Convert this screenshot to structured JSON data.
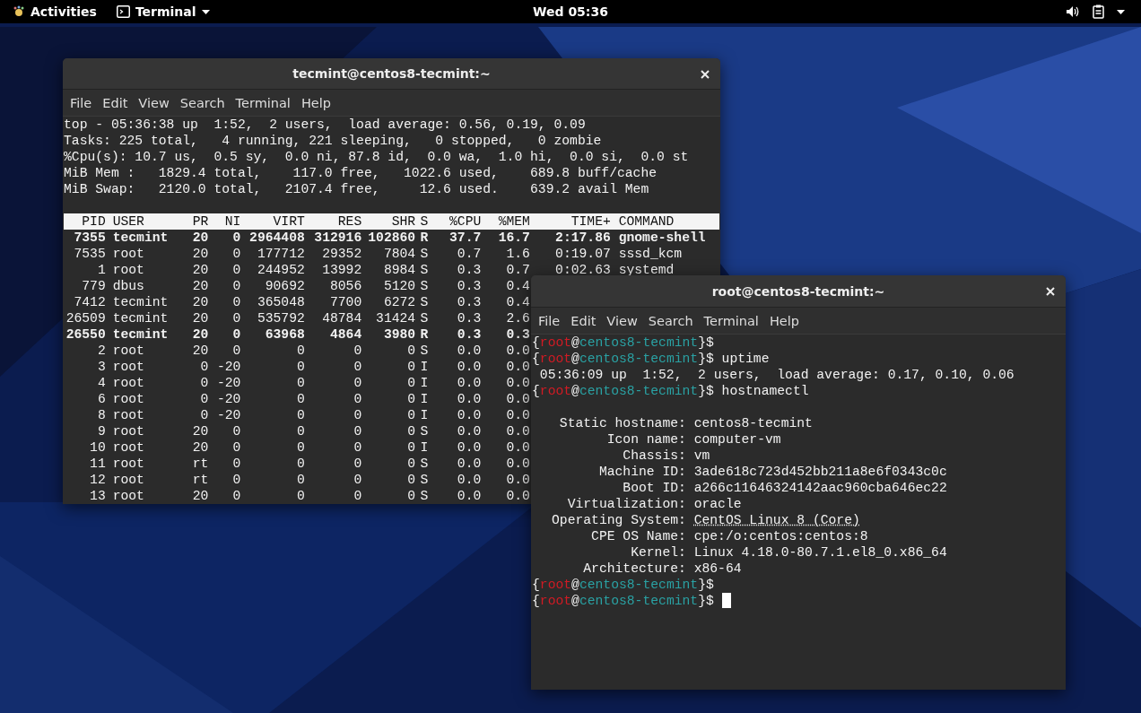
{
  "top_bar": {
    "activities": "Activities",
    "app_menu": "Terminal",
    "clock": "Wed 05:36"
  },
  "windows": [
    {
      "title": "tecmint@centos8-tecmint:~",
      "menu": [
        "File",
        "Edit",
        "View",
        "Search",
        "Terminal",
        "Help"
      ],
      "summary": [
        "top - 05:36:38 up  1:52,  2 users,  load average: 0.56, 0.19, 0.09",
        "Tasks: 225 total,   4 running, 221 sleeping,   0 stopped,   0 zombie",
        "%Cpu(s): 10.7 us,  0.5 sy,  0.0 ni, 87.8 id,  0.0 wa,  1.0 hi,  0.0 si,  0.0 st",
        "MiB Mem :   1829.4 total,    117.0 free,   1022.6 used,    689.8 buff/cache",
        "MiB Swap:   2120.0 total,   2107.4 free,     12.6 used.    639.2 avail Mem"
      ],
      "columns": [
        "PID",
        "USER",
        "PR",
        "NI",
        "VIRT",
        "RES",
        "SHR",
        "S",
        "%CPU",
        "%MEM",
        "TIME+",
        "COMMAND"
      ],
      "rows": [
        {
          "cells": [
            "7355",
            "tecmint",
            "20",
            "0",
            "2964408",
            "312916",
            "102860",
            "R",
            "37.7",
            "16.7",
            "2:17.86",
            "gnome-shell"
          ],
          "bold": true
        },
        {
          "cells": [
            "7535",
            "root",
            "20",
            "0",
            "177712",
            "29352",
            "7804",
            "S",
            "0.7",
            "1.6",
            "0:19.07",
            "sssd_kcm"
          ],
          "bold": false
        },
        {
          "cells": [
            "1",
            "root",
            "20",
            "0",
            "244952",
            "13992",
            "8984",
            "S",
            "0.3",
            "0.7",
            "0:02.63",
            "systemd"
          ],
          "bold": false
        },
        {
          "cells": [
            "779",
            "dbus",
            "20",
            "0",
            "90692",
            "8056",
            "5120",
            "S",
            "0.3",
            "0.4"
          ],
          "bold": false
        },
        {
          "cells": [
            "7412",
            "tecmint",
            "20",
            "0",
            "365048",
            "7700",
            "6272",
            "S",
            "0.3",
            "0.4"
          ],
          "bold": false
        },
        {
          "cells": [
            "26509",
            "tecmint",
            "20",
            "0",
            "535792",
            "48784",
            "31424",
            "S",
            "0.3",
            "2.6"
          ],
          "bold": false
        },
        {
          "cells": [
            "26550",
            "tecmint",
            "20",
            "0",
            "63968",
            "4864",
            "3980",
            "R",
            "0.3",
            "0.3"
          ],
          "bold": true
        },
        {
          "cells": [
            "2",
            "root",
            "20",
            "0",
            "0",
            "0",
            "0",
            "S",
            "0.0",
            "0.0"
          ],
          "bold": false
        },
        {
          "cells": [
            "3",
            "root",
            "0",
            "-20",
            "0",
            "0",
            "0",
            "I",
            "0.0",
            "0.0"
          ],
          "bold": false
        },
        {
          "cells": [
            "4",
            "root",
            "0",
            "-20",
            "0",
            "0",
            "0",
            "I",
            "0.0",
            "0.0"
          ],
          "bold": false
        },
        {
          "cells": [
            "6",
            "root",
            "0",
            "-20",
            "0",
            "0",
            "0",
            "I",
            "0.0",
            "0.0"
          ],
          "bold": false
        },
        {
          "cells": [
            "8",
            "root",
            "0",
            "-20",
            "0",
            "0",
            "0",
            "I",
            "0.0",
            "0.0"
          ],
          "bold": false
        },
        {
          "cells": [
            "9",
            "root",
            "20",
            "0",
            "0",
            "0",
            "0",
            "S",
            "0.0",
            "0.0"
          ],
          "bold": false
        },
        {
          "cells": [
            "10",
            "root",
            "20",
            "0",
            "0",
            "0",
            "0",
            "I",
            "0.0",
            "0.0"
          ],
          "bold": false
        },
        {
          "cells": [
            "11",
            "root",
            "rt",
            "0",
            "0",
            "0",
            "0",
            "S",
            "0.0",
            "0.0"
          ],
          "bold": false
        },
        {
          "cells": [
            "12",
            "root",
            "rt",
            "0",
            "0",
            "0",
            "0",
            "S",
            "0.0",
            "0.0"
          ],
          "bold": false
        },
        {
          "cells": [
            "13",
            "root",
            "20",
            "0",
            "0",
            "0",
            "0",
            "S",
            "0.0",
            "0.0"
          ],
          "bold": false
        }
      ]
    },
    {
      "title": "root@centos8-tecmint:~",
      "menu": [
        "File",
        "Edit",
        "View",
        "Search",
        "Terminal",
        "Help"
      ],
      "lines": [
        {
          "kind": "prompt",
          "open": "{",
          "user": "root",
          "at": "@",
          "host": "centos8-tecmint",
          "close": "}$",
          "cursor": false
        },
        {
          "kind": "prompt",
          "open": "{",
          "user": "root",
          "at": "@",
          "host": "centos8-tecmint",
          "close": "}$",
          "command": "uptime",
          "cursor": false
        },
        {
          "kind": "output",
          "text": " 05:36:09 up  1:52,  2 users,  load average: 0.17, 0.10, 0.06"
        },
        {
          "kind": "prompt",
          "open": "{",
          "user": "root",
          "at": "@",
          "host": "centos8-tecmint",
          "close": "}$",
          "command": "hostnamectl",
          "cursor": false
        },
        {
          "kind": "blank"
        },
        {
          "kind": "field",
          "label": "Static hostname:",
          "value": "centos8-tecmint",
          "underlined": false
        },
        {
          "kind": "field",
          "label": "Icon name:",
          "value": "computer-vm",
          "underlined": false
        },
        {
          "kind": "field",
          "label": "Chassis:",
          "value": "vm",
          "underlined": false
        },
        {
          "kind": "field",
          "label": "Machine ID:",
          "value": "3ade618c723d452bb211a8e6f0343c0c",
          "underlined": false
        },
        {
          "kind": "field",
          "label": "Boot ID:",
          "value": "a266c11646324142aac960cba646ec22",
          "underlined": false
        },
        {
          "kind": "field",
          "label": "Virtualization:",
          "value": "oracle",
          "underlined": false
        },
        {
          "kind": "field",
          "label": "Operating System:",
          "value": "CentOS Linux 8 (Core)",
          "underlined": true
        },
        {
          "kind": "field",
          "label": "CPE OS Name:",
          "value": "cpe:/o:centos:centos:8",
          "underlined": false
        },
        {
          "kind": "field",
          "label": "Kernel:",
          "value": "Linux 4.18.0-80.7.1.el8_0.x86_64",
          "underlined": false
        },
        {
          "kind": "field",
          "label": "Architecture:",
          "value": "x86-64",
          "underlined": false
        },
        {
          "kind": "prompt",
          "open": "{",
          "user": "root",
          "at": "@",
          "host": "centos8-tecmint",
          "close": "}$",
          "cursor": false
        },
        {
          "kind": "prompt",
          "open": "{",
          "user": "root",
          "at": "@",
          "host": "centos8-tecmint",
          "close": "}$",
          "cursor": true
        }
      ]
    }
  ]
}
